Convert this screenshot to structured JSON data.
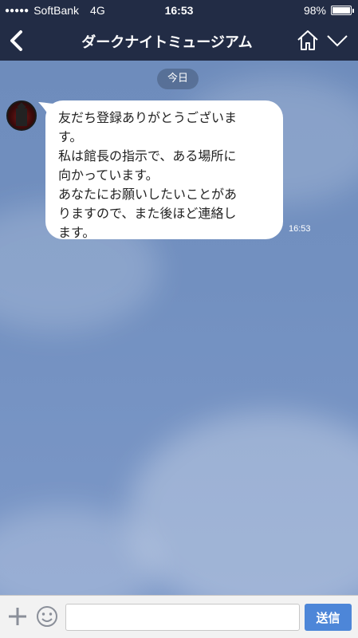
{
  "status_bar": {
    "carrier": "SoftBank",
    "network": "4G",
    "time": "16:53",
    "battery_percent": "98%",
    "battery_level": 0.98
  },
  "header": {
    "title": "ダークナイトミュージアム",
    "icons": [
      "back-chevron-icon",
      "home-icon",
      "chevron-down-icon"
    ]
  },
  "chat": {
    "date_label": "今日",
    "messages": [
      {
        "text": "友だち登録ありがとうございま\nす。\n私は館長の指示で、ある場所に\n向かっています。\nあなたにお願いしたいことがあ\nりますので、また後ほど連絡し\nます。",
        "time": "16:53"
      }
    ]
  },
  "composer": {
    "input_value": "",
    "input_placeholder": "",
    "send_label": "送信",
    "accent_color": "#4d86d8"
  }
}
